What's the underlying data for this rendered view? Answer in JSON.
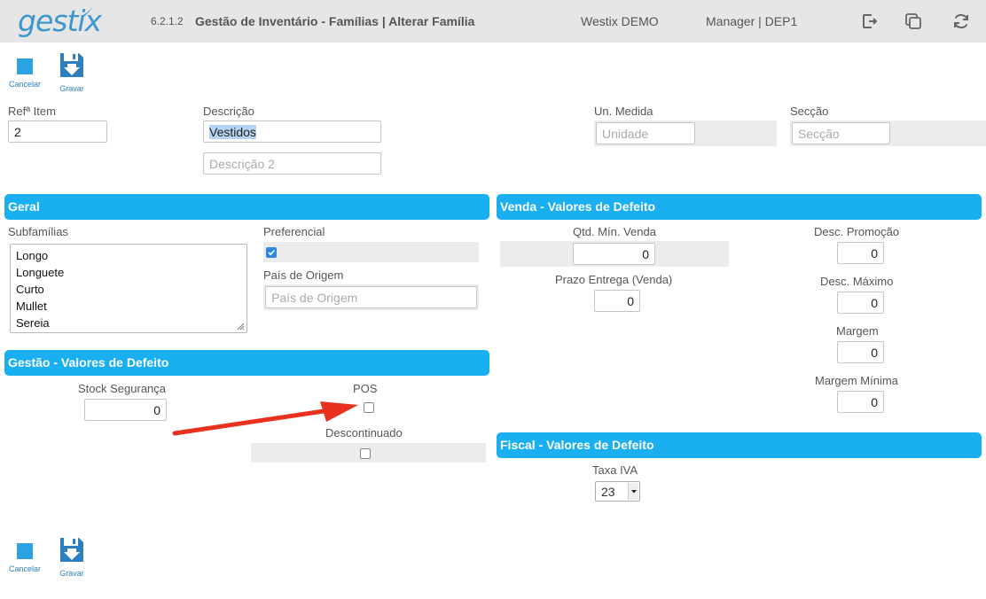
{
  "header": {
    "logo": "gestix",
    "version": "6.2.1.2",
    "title": "Gestão de Inventário - Famílias | Alterar Família",
    "company": "Westix DEMO",
    "user": "Manager | DEP1",
    "icons": [
      "logout-icon",
      "windows-icon",
      "refresh-icon"
    ]
  },
  "toolbar": {
    "cancel_label": "Cancelar",
    "save_label": "Gravar"
  },
  "form": {
    "ref_label": "Refª Item",
    "ref_value": "2",
    "desc_label": "Descrição",
    "desc_value": "Vestidos",
    "desc2_placeholder": "Descrição 2",
    "unit_label": "Un. Medida",
    "unit_placeholder": "Unidade",
    "section_label": "Secção",
    "section_placeholder": "Secção"
  },
  "geral": {
    "title": "Geral",
    "subfam_label": "Subfamílias",
    "subfamilies": [
      "Longo",
      "Longuete",
      "Curto",
      "Mullet",
      "Sereia"
    ],
    "preferencial_label": "Preferencial",
    "preferencial_checked": true,
    "pais_label": "País de Origem",
    "pais_placeholder": "País de Origem"
  },
  "gestao": {
    "title": "Gestão - Valores de Defeito",
    "stock_label": "Stock Segurança",
    "stock_value": "0",
    "pos_label": "POS",
    "pos_checked": false,
    "desc_label": "Descontinuado",
    "desc_checked": false
  },
  "venda": {
    "title": "Venda - Valores de Defeito",
    "qtd_label": "Qtd. Mín. Venda",
    "qtd_value": "0",
    "prazo_label": "Prazo Entrega (Venda)",
    "prazo_value": "0",
    "promo_label": "Desc. Promoção",
    "promo_value": "0",
    "max_label": "Desc. Máximo",
    "max_value": "0",
    "margem_label": "Margem",
    "margem_value": "0",
    "margem_min_label": "Margem Mínima",
    "margem_min_value": "0"
  },
  "fiscal": {
    "title": "Fiscal - Valores de Defeito",
    "iva_label": "Taxa IVA",
    "iva_value": "23"
  },
  "colors": {
    "accent": "#1aaff0",
    "arrow": "#e8321f"
  }
}
